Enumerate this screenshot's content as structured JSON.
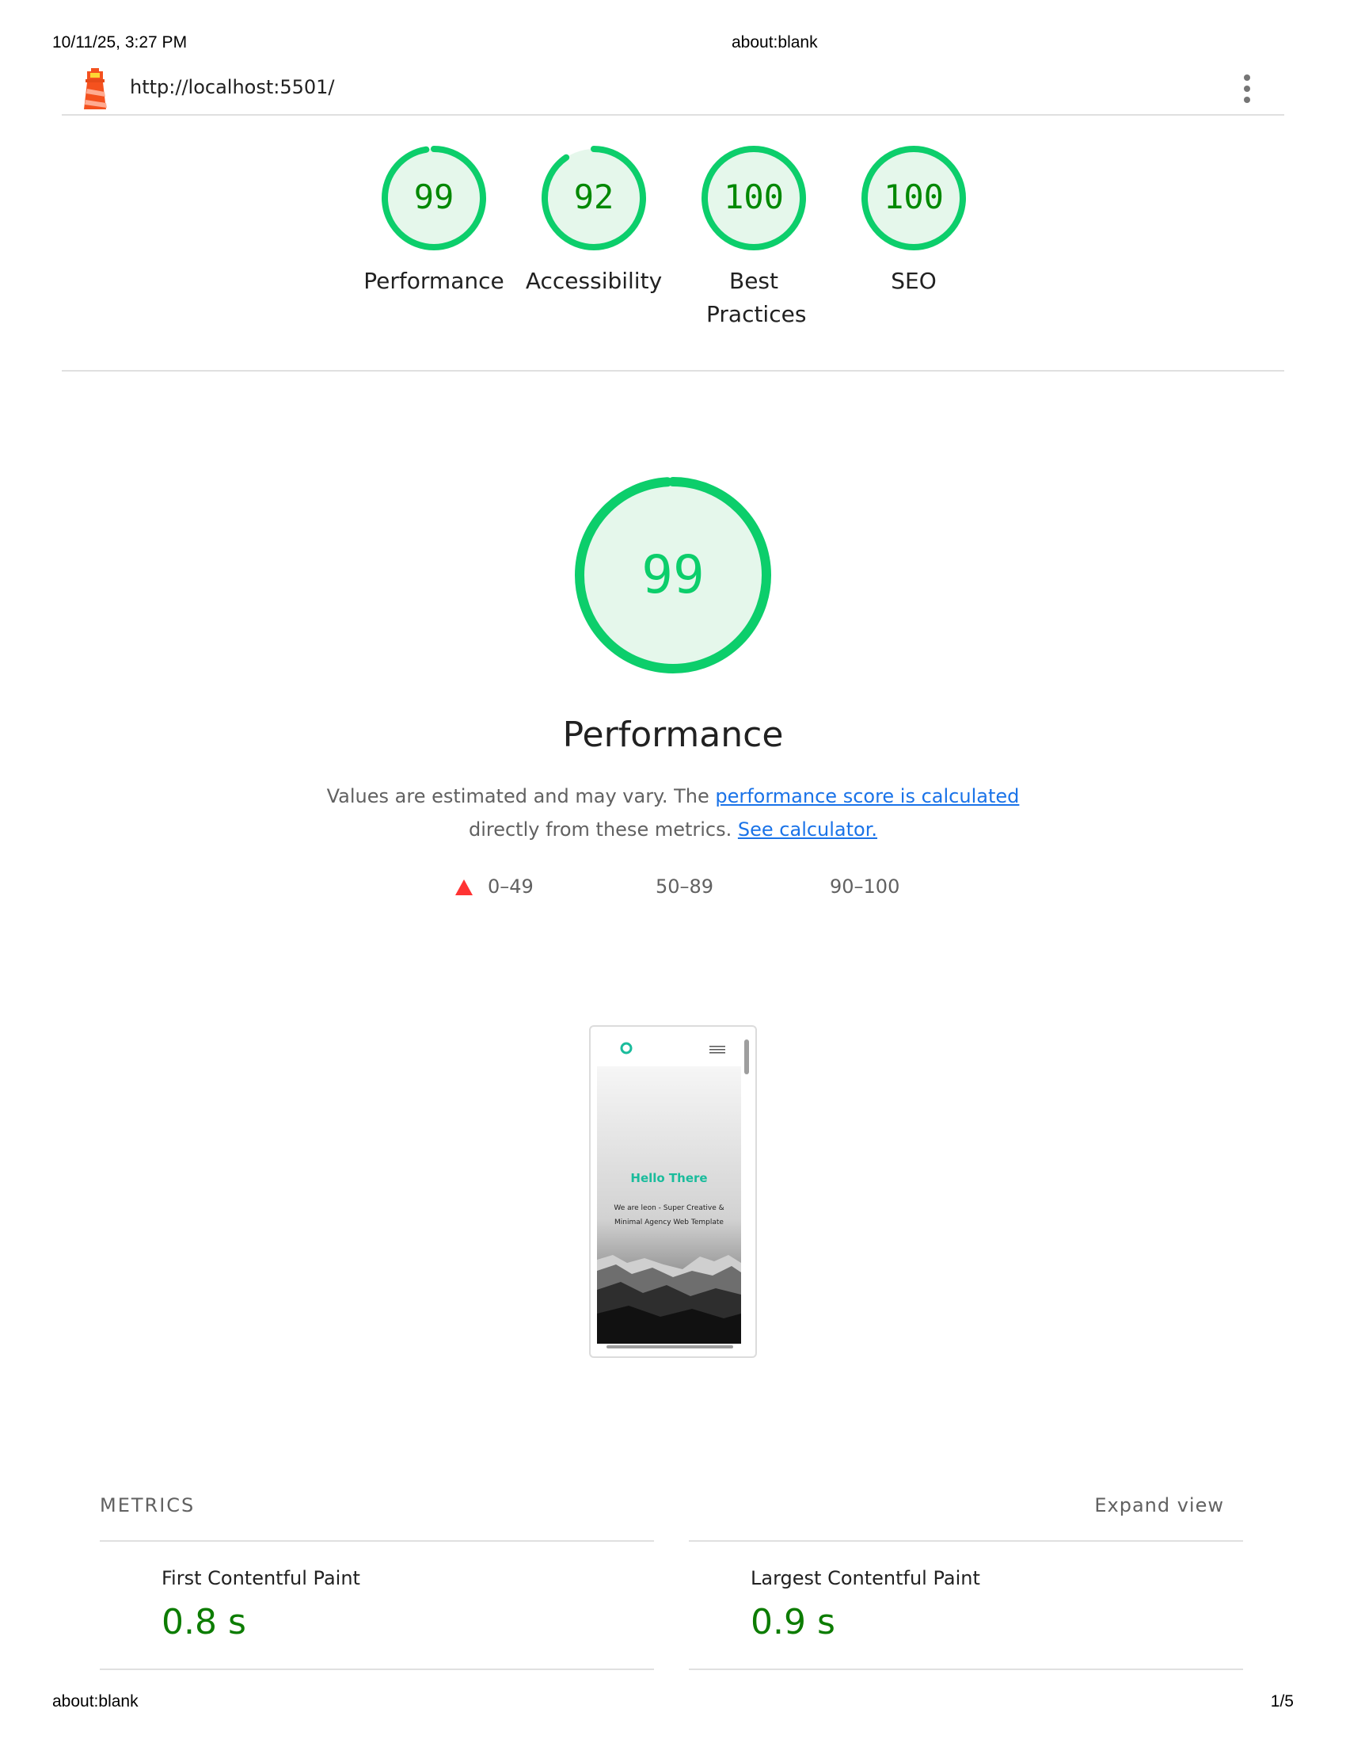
{
  "print_header": {
    "datetime": "10/11/25, 3:27 PM",
    "title": "about:blank"
  },
  "print_footer": {
    "left": "about:blank",
    "page": "1/5"
  },
  "topbar": {
    "url": "http://localhost:5501/",
    "logo_icon": "lighthouse-icon",
    "menu_icon": "kebab-menu-icon"
  },
  "categories": [
    {
      "score": "99",
      "score_fraction": 0.99,
      "label": "Performance"
    },
    {
      "score": "92",
      "score_fraction": 0.92,
      "label": "Accessibility"
    },
    {
      "score": "100",
      "score_fraction": 1.0,
      "label": "Best Practices"
    },
    {
      "score": "100",
      "score_fraction": 1.0,
      "label": "SEO"
    }
  ],
  "colors": {
    "pass": "#0cce6b",
    "pass_text": "#008800",
    "pass_bg": "#e5f7eb",
    "fail": "#ff3333",
    "link": "#1a73e8"
  },
  "performance": {
    "score": "99",
    "score_fraction": 0.99,
    "title": "Performance",
    "desc_prefix": "Values are estimated and may vary. The ",
    "desc_link1": "performance score is calculated",
    "desc_middle": " directly from these metrics. ",
    "desc_link2": "See calculator."
  },
  "legend": [
    {
      "range": "0–49",
      "shape": "triangle"
    },
    {
      "range": "50–89",
      "shape": "square"
    },
    {
      "range": "90–100",
      "shape": "circle"
    }
  ],
  "screenshot": {
    "hero_title": "Hello There",
    "hero_subtitle": "We are leon - Super Creative & Minimal Agency Web Template"
  },
  "metrics": {
    "title": "METRICS",
    "expand_label": "Expand view",
    "items": [
      {
        "label": "First Contentful Paint",
        "value": "0.8 s"
      },
      {
        "label": "Largest Contentful Paint",
        "value": "0.9 s"
      }
    ]
  }
}
